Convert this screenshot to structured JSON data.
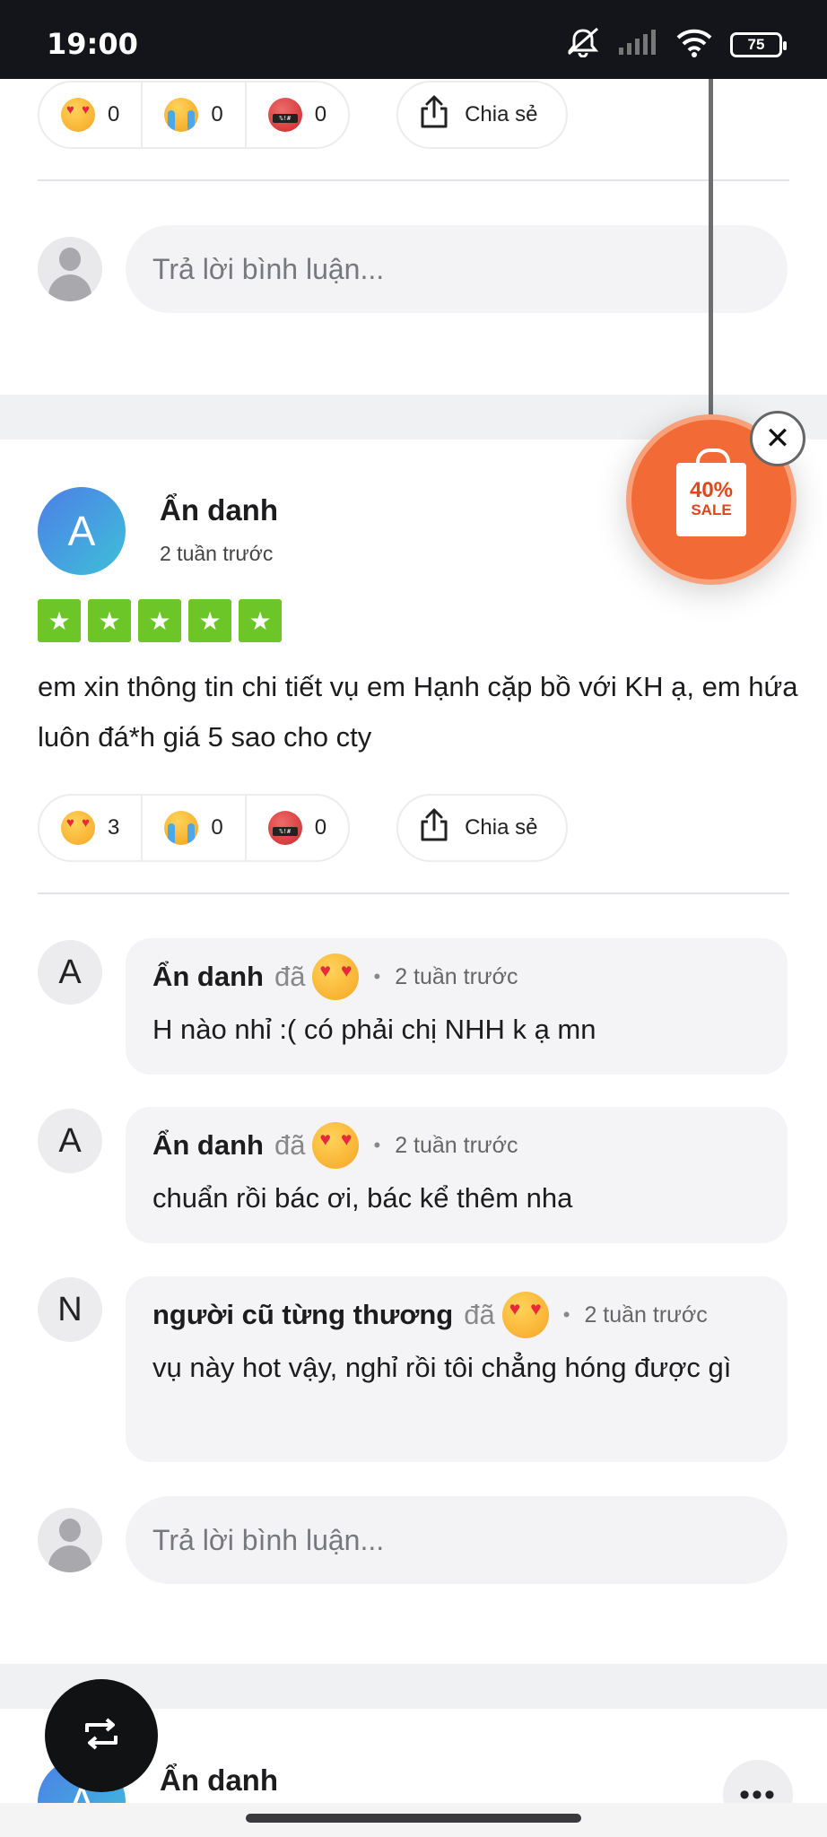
{
  "status_bar": {
    "time": "19:00",
    "battery": "75",
    "icons": [
      "mute-icon",
      "signal-icon",
      "wifi-icon",
      "battery-icon"
    ]
  },
  "top_post": {
    "reactions": [
      {
        "emoji": "love-eyes",
        "count": "0"
      },
      {
        "emoji": "crying",
        "count": "0"
      },
      {
        "emoji": "swearing",
        "count": "0"
      }
    ],
    "share_label": "Chia sẻ",
    "reply_placeholder": "Trả lời bình luận..."
  },
  "review": {
    "avatar_letter": "A",
    "author": "Ẩn danh",
    "time": "2 tuần trước",
    "rating": 5,
    "body": "em xin thông tin chi tiết vụ em Hạnh cặp bồ với KH ạ, em hứa luôn đá*h giá 5 sao cho cty",
    "reactions": [
      {
        "emoji": "love-eyes",
        "count": "3"
      },
      {
        "emoji": "crying",
        "count": "0"
      },
      {
        "emoji": "swearing",
        "count": "0"
      }
    ],
    "share_label": "Chia sẻ",
    "reply_placeholder": "Trả lời bình luận...",
    "comments": [
      {
        "letter": "A",
        "name": "Ẩn danh",
        "verb": "đã",
        "dot": "•",
        "time": "2 tuần trước",
        "text": "H nào nhỉ :( có phải chị NHH k ạ mn"
      },
      {
        "letter": "A",
        "name": "Ẩn danh",
        "verb": "đã",
        "dot": "•",
        "time": "2 tuần trước",
        "text": "chuẩn rồi bác ơi, bác kể thêm nha"
      },
      {
        "letter": "N",
        "name": "người cũ từng thương",
        "verb": "đã",
        "dot": "•",
        "time": "2 tuần trước",
        "text": "vụ này hot vậy, nghỉ rồi tôi chẳng hóng được gì"
      }
    ]
  },
  "sale_widget": {
    "percent": "40%",
    "label": "SALE",
    "close": "✕"
  },
  "next_review": {
    "avatar_letter": "A",
    "author": "Ẩn danh",
    "more": "•••"
  },
  "colors": {
    "star_green": "#6cc627",
    "sale_orange": "#f26a35",
    "avatar_blue": "#4d7ee8"
  }
}
